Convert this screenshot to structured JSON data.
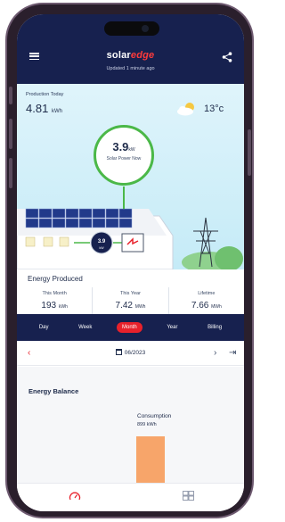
{
  "header": {
    "brand_text": "solar",
    "brand_accent": "edge",
    "updated": "Updated 1 minute ago",
    "menu_icon": "hamburger-menu-icon",
    "share_icon": "share-icon"
  },
  "production": {
    "label": "Production Today",
    "value": "4.81",
    "unit": "kWh"
  },
  "weather": {
    "icon": "partly-cloudy-icon",
    "temperature": "13°c"
  },
  "power_now": {
    "value": "3.9",
    "unit": "kW",
    "label": "Solar Power Now",
    "inverter_value": "3.9",
    "inverter_unit": "kW"
  },
  "energy_produced": {
    "title": "Energy Produced",
    "columns": [
      {
        "header": "This Month",
        "value": "193",
        "unit": "kWh"
      },
      {
        "header": "This Year",
        "value": "7.42",
        "unit": "MWh"
      },
      {
        "header": "Lifetime",
        "value": "7.66",
        "unit": "MWh"
      }
    ]
  },
  "tabs": [
    {
      "label": "Day"
    },
    {
      "label": "Week"
    },
    {
      "label": "Month",
      "active": true
    },
    {
      "label": "Year"
    },
    {
      "label": "Billing"
    }
  ],
  "date_nav": {
    "prev": "‹",
    "date": "06/2023",
    "next": "›",
    "last": "⇥"
  },
  "energy_balance": {
    "title": "Energy Balance",
    "consumption_label": "Consumption",
    "consumption_value": "899 kWh"
  },
  "colors": {
    "navy": "#17214f",
    "accent_red": "#e8212b",
    "solar_green": "#4bb848",
    "consumption_orange": "#f7a56a"
  },
  "bottom_nav": {
    "dashboard_icon": "gauge-icon",
    "layout_icon": "solar-layout-icon"
  }
}
